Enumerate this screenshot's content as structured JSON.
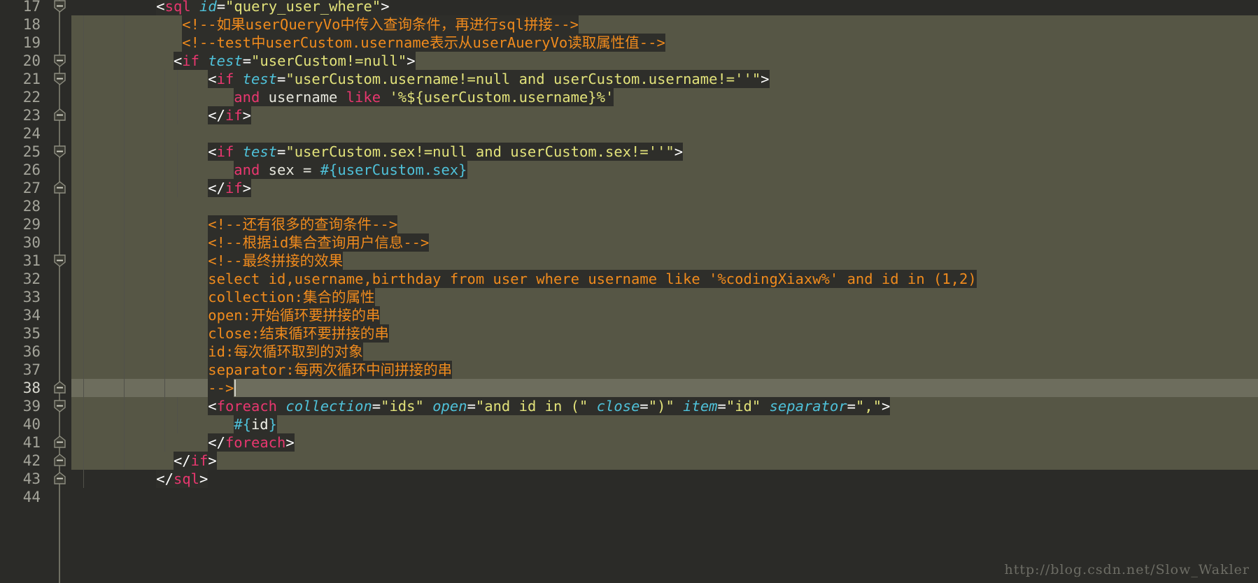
{
  "editor": {
    "name": "code-editor",
    "theme": {
      "background": "#2b2b28",
      "code_background": "#2e2e2a",
      "scope_highlight": "#565645",
      "current_line": "#6d6d5d",
      "gutter_text": "#a4a49a",
      "tag": "#e8376f",
      "attribute": "#4fc1d9",
      "string": "#e2e27a",
      "comment": "#f08b1d",
      "punctuation": "#ffffff",
      "plain": "#e6e6dd",
      "watermark": "#6d6d65"
    },
    "first_line": 17,
    "last_line": 44,
    "current_line": 38,
    "line_numbers": [
      17,
      18,
      19,
      20,
      21,
      22,
      23,
      24,
      25,
      26,
      27,
      28,
      29,
      30,
      31,
      32,
      33,
      34,
      35,
      36,
      37,
      38,
      39,
      40,
      41,
      42,
      43,
      44
    ],
    "fold_markers": [
      {
        "line": 17,
        "type": "collapse-icon"
      },
      {
        "line": 20,
        "type": "collapse-icon"
      },
      {
        "line": 21,
        "type": "collapse-icon"
      },
      {
        "line": 23,
        "type": "collapse-end-icon"
      },
      {
        "line": 25,
        "type": "collapse-icon"
      },
      {
        "line": 27,
        "type": "collapse-end-icon"
      },
      {
        "line": 31,
        "type": "collapse-icon"
      },
      {
        "line": 38,
        "type": "collapse-end-icon"
      },
      {
        "line": 39,
        "type": "collapse-icon"
      },
      {
        "line": 41,
        "type": "collapse-end-icon"
      },
      {
        "line": 42,
        "type": "collapse-end-icon"
      },
      {
        "line": 43,
        "type": "collapse-end-icon"
      }
    ],
    "lines": [
      {
        "n": 17,
        "indent": 10,
        "tokens": [
          {
            "c": "punct",
            "t": "<"
          },
          {
            "c": "tag",
            "t": "sql"
          },
          {
            "c": "plain",
            "t": " "
          },
          {
            "c": "attr",
            "t": "id"
          },
          {
            "c": "eq",
            "t": "="
          },
          {
            "c": "str",
            "t": "\"query_user_where\""
          },
          {
            "c": "punct",
            "t": ">"
          }
        ]
      },
      {
        "n": 18,
        "indent": 13,
        "tokens": [
          {
            "c": "comment",
            "t": "<!--如果userQueryVo中传入查询条件，再进行sql拼接-->"
          }
        ]
      },
      {
        "n": 19,
        "indent": 13,
        "tokens": [
          {
            "c": "comment",
            "t": "<!--test中userCustom.username表示从userAueryVo读取属性值-->"
          }
        ]
      },
      {
        "n": 20,
        "indent": 12,
        "tokens": [
          {
            "c": "punct",
            "t": "<"
          },
          {
            "c": "tag",
            "t": "if"
          },
          {
            "c": "plain",
            "t": " "
          },
          {
            "c": "attr",
            "t": "test"
          },
          {
            "c": "eq",
            "t": "="
          },
          {
            "c": "str",
            "t": "\"userCustom!=null\""
          },
          {
            "c": "punct",
            "t": ">"
          }
        ]
      },
      {
        "n": 21,
        "indent": 16,
        "tokens": [
          {
            "c": "punct",
            "t": "<"
          },
          {
            "c": "tag",
            "t": "if"
          },
          {
            "c": "plain",
            "t": " "
          },
          {
            "c": "attr",
            "t": "test"
          },
          {
            "c": "eq",
            "t": "="
          },
          {
            "c": "str",
            "t": "\"userCustom.username!=null and userCustom.username!=''\""
          },
          {
            "c": "punct",
            "t": ">"
          }
        ]
      },
      {
        "n": 22,
        "indent": 19,
        "tokens": [
          {
            "c": "kw",
            "t": "and"
          },
          {
            "c": "plain",
            "t": " username "
          },
          {
            "c": "kw",
            "t": "like"
          },
          {
            "c": "plain",
            "t": " "
          },
          {
            "c": "str",
            "t": "'%${userCustom.username}%'"
          }
        ]
      },
      {
        "n": 23,
        "indent": 16,
        "tokens": [
          {
            "c": "punct",
            "t": "</"
          },
          {
            "c": "tag",
            "t": "if"
          },
          {
            "c": "punct",
            "t": ">"
          }
        ]
      },
      {
        "n": 24,
        "indent": 0,
        "tokens": []
      },
      {
        "n": 25,
        "indent": 16,
        "tokens": [
          {
            "c": "punct",
            "t": "<"
          },
          {
            "c": "tag",
            "t": "if"
          },
          {
            "c": "plain",
            "t": " "
          },
          {
            "c": "attr",
            "t": "test"
          },
          {
            "c": "eq",
            "t": "="
          },
          {
            "c": "str",
            "t": "\"userCustom.sex!=null and userCustom.sex!=''\""
          },
          {
            "c": "punct",
            "t": ">"
          }
        ]
      },
      {
        "n": 26,
        "indent": 19,
        "tokens": [
          {
            "c": "kw",
            "t": "and"
          },
          {
            "c": "plain",
            "t": " sex = "
          },
          {
            "c": "el",
            "t": "#{userCustom.sex}"
          }
        ]
      },
      {
        "n": 27,
        "indent": 16,
        "tokens": [
          {
            "c": "punct",
            "t": "</"
          },
          {
            "c": "tag",
            "t": "if"
          },
          {
            "c": "punct",
            "t": ">"
          }
        ]
      },
      {
        "n": 28,
        "indent": 0,
        "tokens": []
      },
      {
        "n": 29,
        "indent": 16,
        "tokens": [
          {
            "c": "comment",
            "t": "<!--还有很多的查询条件-->"
          }
        ]
      },
      {
        "n": 30,
        "indent": 16,
        "tokens": [
          {
            "c": "comment",
            "t": "<!--根据id集合查询用户信息-->"
          }
        ]
      },
      {
        "n": 31,
        "indent": 16,
        "tokens": [
          {
            "c": "comment",
            "t": "<!--最终拼接的效果"
          }
        ]
      },
      {
        "n": 32,
        "indent": 16,
        "tokens": [
          {
            "c": "comment",
            "t": "select id,username,birthday from user where username like '%codingXiaxw%' and id in (1,2)"
          }
        ]
      },
      {
        "n": 33,
        "indent": 16,
        "tokens": [
          {
            "c": "comment",
            "t": "collection:集合的属性"
          }
        ]
      },
      {
        "n": 34,
        "indent": 16,
        "tokens": [
          {
            "c": "comment",
            "t": "open:开始循环要拼接的串"
          }
        ]
      },
      {
        "n": 35,
        "indent": 16,
        "tokens": [
          {
            "c": "comment",
            "t": "close:结束循环要拼接的串"
          }
        ]
      },
      {
        "n": 36,
        "indent": 16,
        "tokens": [
          {
            "c": "comment",
            "t": "id:每次循环取到的对象"
          }
        ]
      },
      {
        "n": 37,
        "indent": 16,
        "tokens": [
          {
            "c": "comment",
            "t": "separator:每两次循环中间拼接的串"
          }
        ]
      },
      {
        "n": 38,
        "indent": 16,
        "tokens": [
          {
            "c": "comment",
            "t": "-->"
          }
        ]
      },
      {
        "n": 39,
        "indent": 16,
        "tokens": [
          {
            "c": "punct",
            "t": "<"
          },
          {
            "c": "tag",
            "t": "foreach"
          },
          {
            "c": "plain",
            "t": " "
          },
          {
            "c": "attr",
            "t": "collection"
          },
          {
            "c": "eq",
            "t": "="
          },
          {
            "c": "str",
            "t": "\"ids\""
          },
          {
            "c": "plain",
            "t": " "
          },
          {
            "c": "attr",
            "t": "open"
          },
          {
            "c": "eq",
            "t": "="
          },
          {
            "c": "str",
            "t": "\"and id in (\""
          },
          {
            "c": "plain",
            "t": " "
          },
          {
            "c": "attr",
            "t": "close"
          },
          {
            "c": "eq",
            "t": "="
          },
          {
            "c": "str",
            "t": "\")\""
          },
          {
            "c": "plain",
            "t": " "
          },
          {
            "c": "attr",
            "t": "item"
          },
          {
            "c": "eq",
            "t": "="
          },
          {
            "c": "str",
            "t": "\"id\""
          },
          {
            "c": "plain",
            "t": " "
          },
          {
            "c": "attr",
            "t": "separator"
          },
          {
            "c": "eq",
            "t": "="
          },
          {
            "c": "str",
            "t": "\",\""
          },
          {
            "c": "punct",
            "t": ">"
          }
        ]
      },
      {
        "n": 40,
        "indent": 19,
        "tokens": [
          {
            "c": "el",
            "t": "#{"
          },
          {
            "c": "white",
            "t": "id"
          },
          {
            "c": "el",
            "t": "}"
          }
        ]
      },
      {
        "n": 41,
        "indent": 16,
        "tokens": [
          {
            "c": "punct",
            "t": "</"
          },
          {
            "c": "tag",
            "t": "foreach"
          },
          {
            "c": "punct",
            "t": ">"
          }
        ]
      },
      {
        "n": 42,
        "indent": 12,
        "tokens": [
          {
            "c": "punct",
            "t": "</"
          },
          {
            "c": "tag",
            "t": "if"
          },
          {
            "c": "punct",
            "t": ">"
          }
        ]
      },
      {
        "n": 43,
        "indent": 10,
        "tokens": [
          {
            "c": "punct",
            "t": "</"
          },
          {
            "c": "tag",
            "t": "sql"
          },
          {
            "c": "punct",
            "t": ">"
          }
        ]
      },
      {
        "n": 44,
        "indent": 0,
        "tokens": []
      }
    ]
  },
  "watermark": {
    "text": "http://blog.csdn.net/Slow_Wakler"
  }
}
